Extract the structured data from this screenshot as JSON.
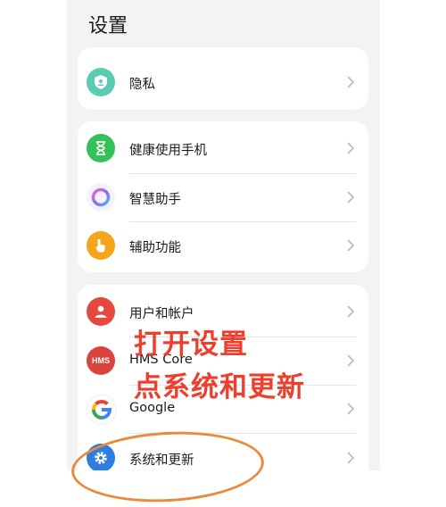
{
  "page_title": "设置",
  "groups": [
    {
      "items": [
        {
          "label": "隐私",
          "icon": "privacy-shield-icon",
          "color": "#5ccbb4"
        }
      ]
    },
    {
      "items": [
        {
          "label": "健康使用手机",
          "icon": "hourglass-icon",
          "color": "#35c05a"
        },
        {
          "label": "智慧助手",
          "icon": "assistant-ring-icon",
          "color": "#8b6cf0"
        },
        {
          "label": "辅助功能",
          "icon": "hand-pointer-icon",
          "color": "#f4a51c"
        }
      ]
    },
    {
      "items": [
        {
          "label": "用户和帐户",
          "icon": "user-icon",
          "color": "#e5483c"
        },
        {
          "label": "HMS Core",
          "icon": "hms-icon",
          "icon_text": "HMS",
          "color": "#d9453d"
        },
        {
          "label": "Google",
          "icon": "google-icon",
          "icon_text": "G",
          "color": "#4285f4"
        },
        {
          "label": "系统和更新",
          "icon": "gear-icon",
          "color": "#2f7de1"
        }
      ]
    }
  ],
  "annotation": {
    "line1": "打开设置",
    "line2": "点系统和更新",
    "color": "#ee3f2d",
    "circle_color": "#e98a3c"
  }
}
